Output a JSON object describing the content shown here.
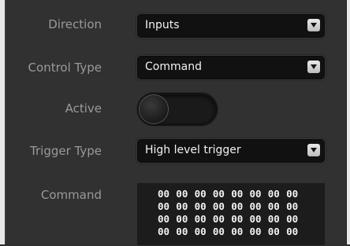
{
  "form": {
    "direction": {
      "label": "Direction",
      "value": "Inputs"
    },
    "control_type": {
      "label": "Control Type",
      "value": "Command"
    },
    "active": {
      "label": "Active",
      "state": "off"
    },
    "trigger_type": {
      "label": "Trigger Type",
      "value": "High level trigger"
    },
    "command": {
      "label": "Command",
      "rows": [
        [
          "00",
          "00",
          "00",
          "00",
          "00",
          "00",
          "00",
          "00"
        ],
        [
          "00",
          "00",
          "00",
          "00",
          "00",
          "00",
          "00",
          "00"
        ],
        [
          "00",
          "00",
          "00",
          "00",
          "00",
          "00",
          "00",
          "00"
        ],
        [
          "00",
          "00",
          "00",
          "00",
          "00",
          "00",
          "00",
          "00"
        ]
      ]
    }
  },
  "colors": {
    "background": "#313131",
    "label": "#9a9a9a",
    "field": "#111111",
    "text": "#f2f2f2"
  }
}
